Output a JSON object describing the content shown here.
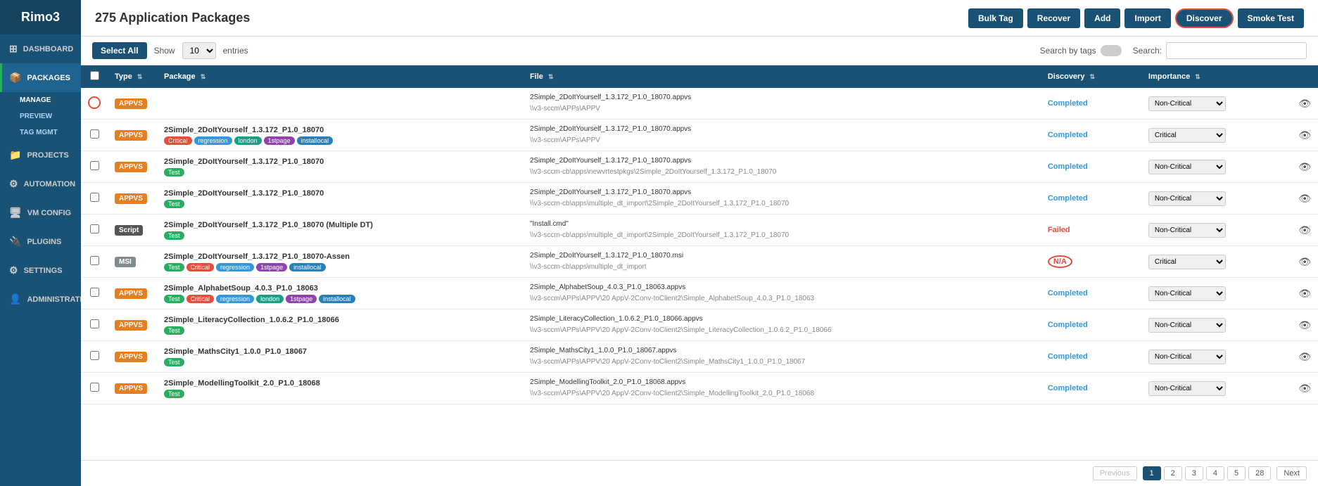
{
  "app": {
    "name": "Rimo3"
  },
  "sidebar": {
    "items": [
      {
        "id": "dashboard",
        "label": "Dashboard",
        "icon": "⊞",
        "active": false
      },
      {
        "id": "packages",
        "label": "Packages",
        "icon": "📦",
        "active": true
      },
      {
        "id": "projects",
        "label": "Projects",
        "icon": "📁",
        "active": false
      },
      {
        "id": "automation",
        "label": "Automation",
        "icon": "⚙",
        "active": false
      },
      {
        "id": "vm-config",
        "label": "VM Config",
        "icon": "🖥",
        "active": false
      },
      {
        "id": "plugins",
        "label": "Plugins",
        "icon": "🔌",
        "active": false
      },
      {
        "id": "settings",
        "label": "Settings",
        "icon": "⚙",
        "active": false
      },
      {
        "id": "administration",
        "label": "Administration",
        "icon": "👤",
        "active": false
      }
    ],
    "sub_items": [
      {
        "id": "manage",
        "label": "Manage",
        "active": true
      },
      {
        "id": "preview",
        "label": "Preview",
        "active": false
      },
      {
        "id": "tag-mgmt",
        "label": "Tag Mgmt",
        "active": false
      }
    ]
  },
  "header": {
    "title": "275 Application Packages",
    "buttons": {
      "bulk_tag": "Bulk Tag",
      "recover": "Recover",
      "add": "Add",
      "import": "Import",
      "discover": "Discover",
      "smoke_test": "Smoke Test"
    }
  },
  "toolbar": {
    "select_all": "Select All",
    "show_label": "Show",
    "show_value": "10",
    "entries_label": "entries",
    "search_by_tags_label": "Search by tags",
    "search_label": "Search:",
    "search_placeholder": ""
  },
  "table": {
    "columns": [
      "",
      "Type",
      "Package",
      "File",
      "Discovery",
      "Importance",
      ""
    ],
    "rows": [
      {
        "type": "APPVS",
        "type_badge": "appvs",
        "package_name": "",
        "tags": [],
        "file_main": "2Simple_2DoItYourself_1.3.172_P1.0_18070.appvs",
        "file_sub": "\\\\v3-sccm\\APPs\\APPV",
        "discovery": "Completed",
        "importance": "Non-Critical",
        "has_circle": true
      },
      {
        "type": "APPVS",
        "type_badge": "appvs",
        "package_name": "2Simple_2DoItYourself_1.3.172_P1.0_18070",
        "tags": [
          "Critical",
          "regression",
          "london",
          "1stpage",
          "installocal"
        ],
        "tag_styles": [
          "critical",
          "regression",
          "london",
          "tag-1stpage",
          "installocal"
        ],
        "file_main": "2Simple_2DoItYourself_1.3.172_P1.0_18070.appvs",
        "file_sub": "\\\\v3-sccm\\APPs\\APPV",
        "discovery": "Completed",
        "importance": "Critical"
      },
      {
        "type": "APPVS",
        "type_badge": "appvs",
        "package_name": "2Simple_2DoItYourself_1.3.172_P1.0_18070",
        "tags": [
          "Test"
        ],
        "tag_styles": [
          "test"
        ],
        "file_main": "2Simple_2DoItYourself_1.3.172_P1.0_18070.appvs",
        "file_sub": "\\\\v3-sccm-cb\\apps\\newvrtestpkgs\\2Simple_2DoItYourself_1.3.172_P1.0_18070",
        "discovery": "Completed",
        "importance": "Non-Critical"
      },
      {
        "type": "APPVS",
        "type_badge": "appvs",
        "package_name": "2Simple_2DoItYourself_1.3.172_P1.0_18070",
        "tags": [
          "Test"
        ],
        "tag_styles": [
          "test"
        ],
        "file_main": "2Simple_2DoItYourself_1.3.172_P1.0_18070.appvs",
        "file_sub": "\\\\v3-sccm-cb\\apps\\multiple_dt_import\\2Simple_2DoItYourself_1.3.172_P1.0_18070",
        "discovery": "Completed",
        "importance": "Non-Critical"
      },
      {
        "type": "Script",
        "type_badge": "script",
        "package_name": "2Simple_2DoItYourself_1.3.172_P1.0_18070 (Multiple DT)",
        "tags": [
          "Test"
        ],
        "tag_styles": [
          "test"
        ],
        "file_main": "\"Install.cmd\"",
        "file_sub": "\\\\v3-sccm-cb\\apps\\multiple_dt_import\\2Simple_2DoItYourself_1.3.172_P1.0_18070",
        "discovery": "Failed",
        "importance": "Non-Critical"
      },
      {
        "type": "MSI",
        "type_badge": "msi",
        "package_name": "2Simple_2DoItYourself_1.3.172_P1.0_18070-Assen",
        "tags": [
          "Test",
          "Critical",
          "regression",
          "1stpage",
          "installocal"
        ],
        "tag_styles": [
          "test",
          "critical",
          "regression",
          "tag-1stpage",
          "installocal"
        ],
        "file_main": "2Simple_2DoItYourself_1.3.172_P1.0_18070.msi",
        "file_sub": "\\\\v3-sccm-cb\\apps\\multiple_dt_import",
        "discovery": "N/A",
        "importance": "Critical"
      },
      {
        "type": "APPVS",
        "type_badge": "appvs",
        "package_name": "2Simple_AlphabetSoup_4.0.3_P1.0_18063",
        "tags": [
          "Test",
          "Critical",
          "regression",
          "london",
          "1stpage",
          "installocal"
        ],
        "tag_styles": [
          "test",
          "critical",
          "regression",
          "london",
          "tag-1stpage",
          "installocal"
        ],
        "file_main": "2Simple_AlphabetSoup_4.0.3_P1.0_18063.appvs",
        "file_sub": "\\\\v3-sccm\\APPs\\APPV\\20 AppV-2Conv-toClient2\\Simple_AlphabetSoup_4.0.3_P1.0_18063",
        "discovery": "Completed",
        "importance": "Non-Critical"
      },
      {
        "type": "APPVS",
        "type_badge": "appvs",
        "package_name": "2Simple_LiteracyCollection_1.0.6.2_P1.0_18066",
        "tags": [
          "Test"
        ],
        "tag_styles": [
          "test"
        ],
        "file_main": "2Simple_LiteracyCollection_1.0.6.2_P1.0_18066.appvs",
        "file_sub": "\\\\v3-sccm\\APPs\\APPV\\20 AppV-2Conv-toClient2\\Simple_LiteracyCollection_1.0.6.2_P1.0_18066",
        "discovery": "Completed",
        "importance": "Non-Critical"
      },
      {
        "type": "APPVS",
        "type_badge": "appvs",
        "package_name": "2Simple_MathsCity1_1.0.0_P1.0_18067",
        "tags": [
          "Test"
        ],
        "tag_styles": [
          "test"
        ],
        "file_main": "2Simple_MathsCity1_1.0.0_P1.0_18067.appvs",
        "file_sub": "\\\\v3-sccm\\APPs\\APPV\\20 AppV-2Conv-toClient2\\Simple_MathsCity1_1.0.0_P1.0_18067",
        "discovery": "Completed",
        "importance": "Non-Critical"
      },
      {
        "type": "APPVS",
        "type_badge": "appvs",
        "package_name": "2Simple_ModellingToolkit_2.0_P1.0_18068",
        "tags": [
          "Test"
        ],
        "tag_styles": [
          "test"
        ],
        "file_main": "2Simple_ModellingToolkit_2.0_P1.0_18068.appvs",
        "file_sub": "\\\\v3-sccm\\APPs\\APPV\\20 AppV-2Conv-toClient2\\Simple_ModellingToolkit_2.0_P1.0_18068",
        "discovery": "Completed",
        "importance": "Non-Critical"
      }
    ]
  },
  "pagination": {
    "previous": "Previous",
    "next": "Next",
    "pages": [
      "1",
      "2",
      "3",
      "4",
      "5",
      "28"
    ],
    "active_page": "1"
  }
}
